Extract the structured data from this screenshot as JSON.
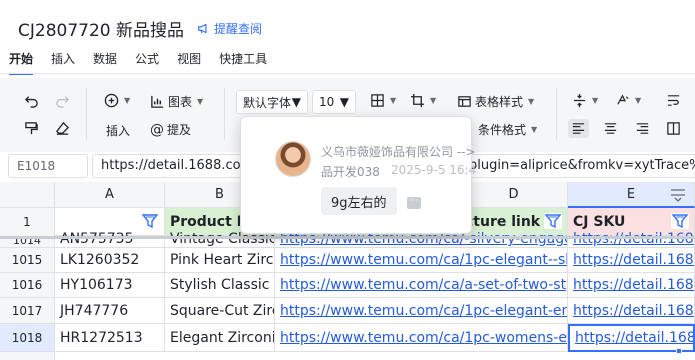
{
  "title": "CJ2807720 新品搜品",
  "remind_label": "提醒查阅",
  "menu": [
    {
      "label": "开始",
      "active": true
    },
    {
      "label": "插入",
      "active": false
    },
    {
      "label": "数据",
      "active": false
    },
    {
      "label": "公式",
      "active": false
    },
    {
      "label": "视图",
      "active": false
    },
    {
      "label": "快捷工具",
      "active": false
    }
  ],
  "toolbar": {
    "insert_label": "插入",
    "mention_label": "提及",
    "chart_label": "图表",
    "font_name": "默认字体",
    "font_size": "10",
    "table_style_label": "表格样式",
    "conditional_format_label": "条件格式"
  },
  "namebox": "E1018",
  "formula": "https://detail.1688.com/offer/...?spm=a2639h.29135425.offerlist.i0&plugin=aliprice&fromkv=xytTrace%3A",
  "formula_visible_start": "https://detail.1688.com",
  "formula_visible_end": "plugin=aliprice&fromkv=xytTrace%3A",
  "columns": {
    "a": "A",
    "b": "B",
    "d": "D",
    "e": "E"
  },
  "header_row": {
    "num": "1",
    "b": "Product Na",
    "d": "cture link",
    "e": "CJ SKU"
  },
  "rows": [
    {
      "num": "1014",
      "a": "AN575735",
      "b": "Vintage Classic",
      "d": "https://www.temu.com/ca/-silvery-engageme",
      "e": "https://detail.1688.c"
    },
    {
      "num": "1015",
      "a": "LK1260352",
      "b": "Pink Heart Zirco",
      "d": "https://www.temu.com/ca/1pc-elegant--shape",
      "e": "https://detail.1688.c"
    },
    {
      "num": "1016",
      "a": "HY106173",
      "b": "Stylish Classic H",
      "d": "https://www.temu.com/ca/a-set-of-two-stylish",
      "e": "https://detail.1688.c"
    },
    {
      "num": "1017",
      "a": "JH747776",
      "b": "Square-Cut Zirc",
      "d": "https://www.temu.com/ca/1pc-elegant-engag",
      "e": "https://detail.1688.c"
    },
    {
      "num": "1018",
      "a": "HR1272513",
      "b": "Elegant Zirconia",
      "d": "https://www.temu.com/ca/1pc-womens-enga",
      "e": "https://detail.1688.c"
    }
  ],
  "comment": {
    "company": "义乌市薇娅饰品有限公司 -->",
    "author": "品开发038",
    "time": "2025-9-5 16:4",
    "text": "9g左右的",
    "more": "···"
  },
  "colors": {
    "accent": "#3370ff",
    "link": "#245bdb",
    "header_green": "#d9f0d3",
    "header_pink": "#fbe0e2",
    "selection": "#3370ff"
  }
}
